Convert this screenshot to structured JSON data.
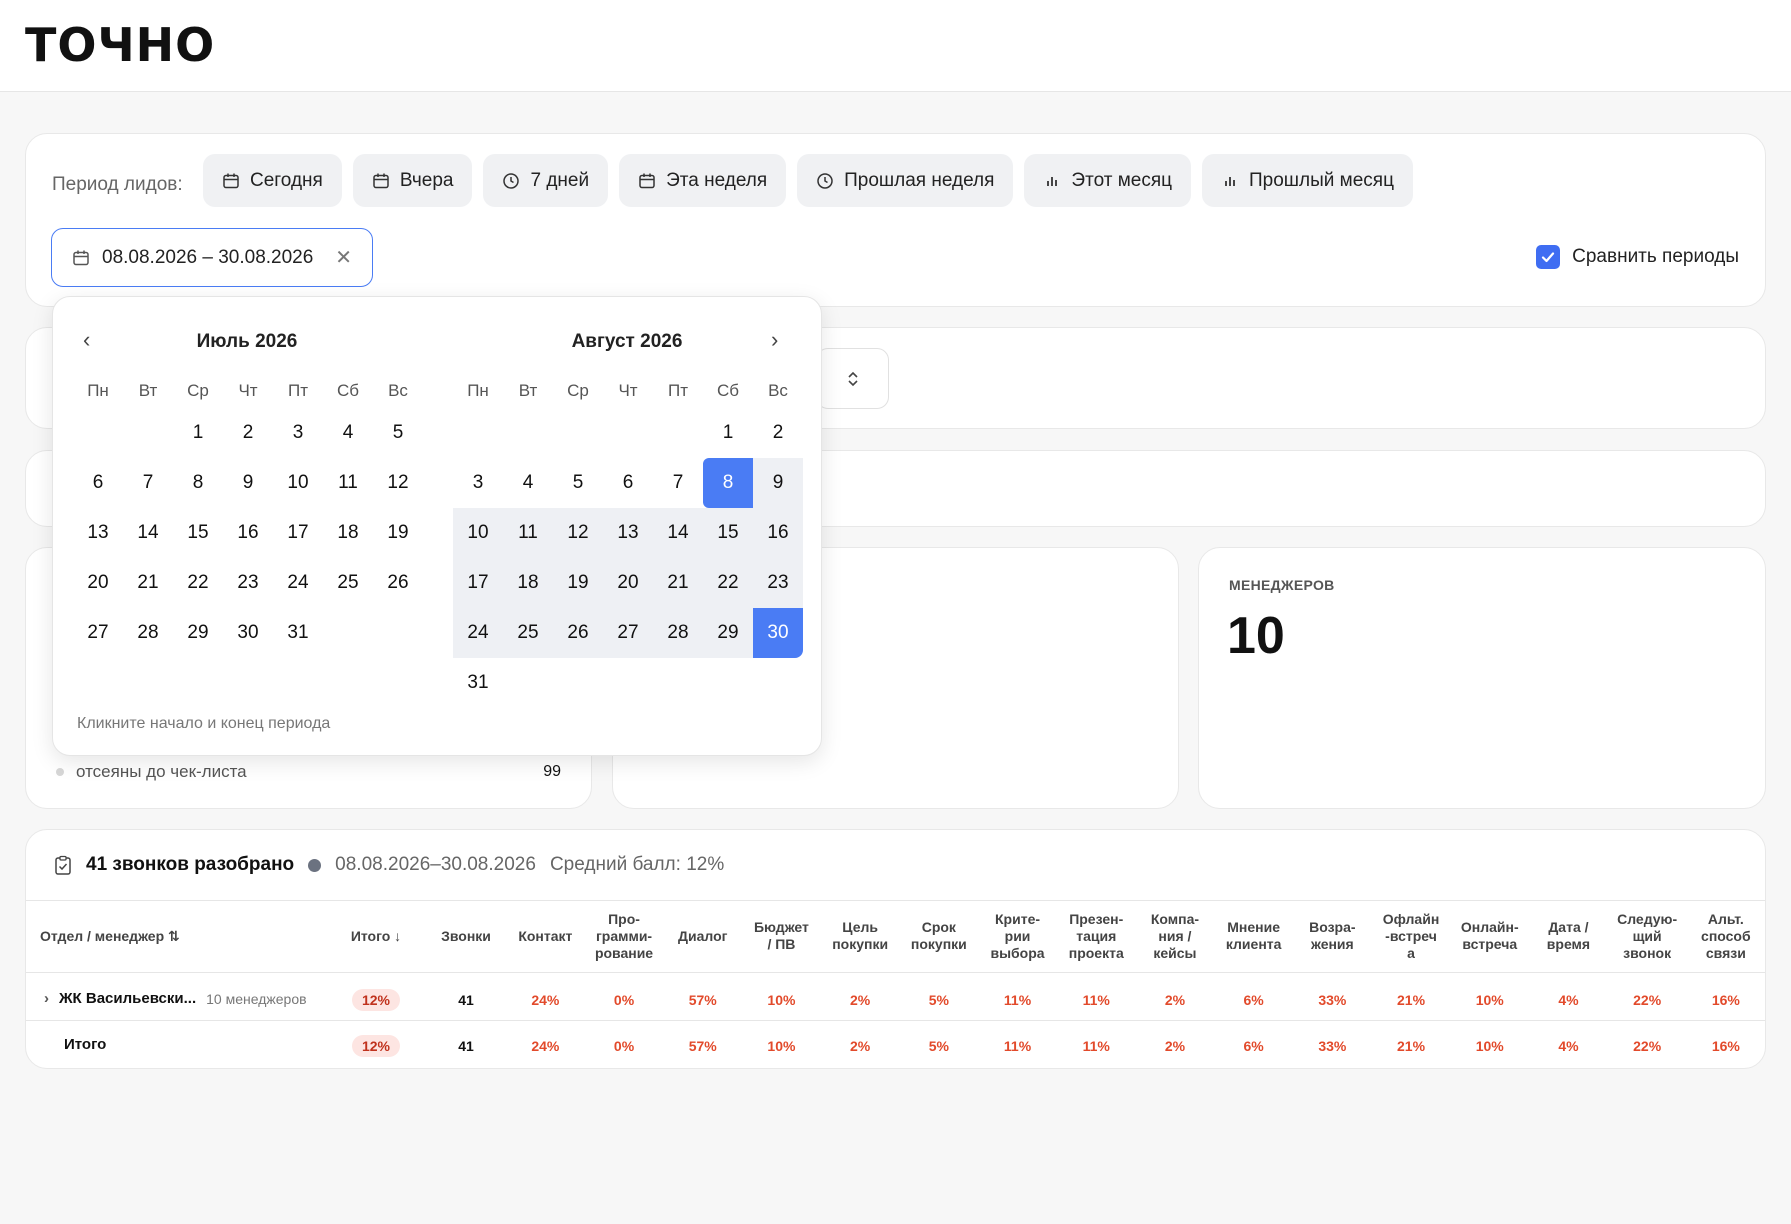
{
  "app": {
    "logo": "ТОЧНО"
  },
  "filter": {
    "period_label": "Период лидов:",
    "chips": [
      {
        "label": "Сегодня",
        "icon": "calendar-icon"
      },
      {
        "label": "Вчера",
        "icon": "calendar-icon"
      },
      {
        "label": "7 дней",
        "icon": "clock-icon"
      },
      {
        "label": "Эта неделя",
        "icon": "calendar-icon"
      },
      {
        "label": "Прошлая неделя",
        "icon": "clock-icon"
      },
      {
        "label": "Этот месяц",
        "icon": "bar-chart-icon"
      },
      {
        "label": "Прошлый месяц",
        "icon": "bar-chart-icon"
      }
    ],
    "date_range": "08.08.2026 – 30.08.2026",
    "compare_label": "Сравнить периоды",
    "compare_checked": true
  },
  "calendar": {
    "left_title": "Июль 2026",
    "right_title": "Август 2026",
    "weekdays": [
      "Пн",
      "Вт",
      "Ср",
      "Чт",
      "Пт",
      "Сб",
      "Вс"
    ],
    "hint": "Кликните начало и конец периода",
    "range_start": 8,
    "range_end": 30
  },
  "stats": {
    "status_label": "отсеяны до чек-листа",
    "status_value": "99",
    "managers_label": "МЕНЕДЖЕРОВ",
    "managers_value": "10"
  },
  "table": {
    "title": "41 звонков разобрано",
    "period": "08.08.2026–30.08.2026",
    "avg": "Средний балл: 12%",
    "col_dept": "Отдел / менеджер",
    "col_total": "Итого",
    "col_calls": "Звонки",
    "columns": [
      "Контакт",
      "Про-\nграмми-\nрование",
      "Диалог",
      "Бюджет\n/ ПВ",
      "Цель\nпокупки",
      "Срок\nпокупки",
      "Крите-\nрии\nвыбора",
      "Презен-\nтация\nпроекта",
      "Компа-\nния /\nкейсы",
      "Мнение\nклиента",
      "Возра-\nжения",
      "Офлайн\n-встреч\nа",
      "Онлайн-\nвстреча",
      "Дата /\nвремя",
      "Следую-\nщий\nзвонок",
      "Альт.\nспособ\nсвязи"
    ],
    "rows": [
      {
        "name": "ЖК Васильевски...",
        "sub": "10 менеджеров",
        "total": "12%",
        "calls": "41",
        "values": [
          "24%",
          "0%",
          "57%",
          "10%",
          "2%",
          "5%",
          "11%",
          "11%",
          "2%",
          "6%",
          "33%",
          "21%",
          "10%",
          "4%",
          "22%",
          "16%"
        ]
      },
      {
        "name": "Итого",
        "sub": "",
        "total": "12%",
        "calls": "41",
        "values": [
          "24%",
          "0%",
          "57%",
          "10%",
          "2%",
          "5%",
          "11%",
          "11%",
          "2%",
          "6%",
          "33%",
          "21%",
          "10%",
          "4%",
          "22%",
          "16%"
        ]
      }
    ]
  },
  "colors": {
    "accent": "#4a7cf4",
    "danger": "#e24a2b",
    "badge_bg": "#fde5e2"
  }
}
